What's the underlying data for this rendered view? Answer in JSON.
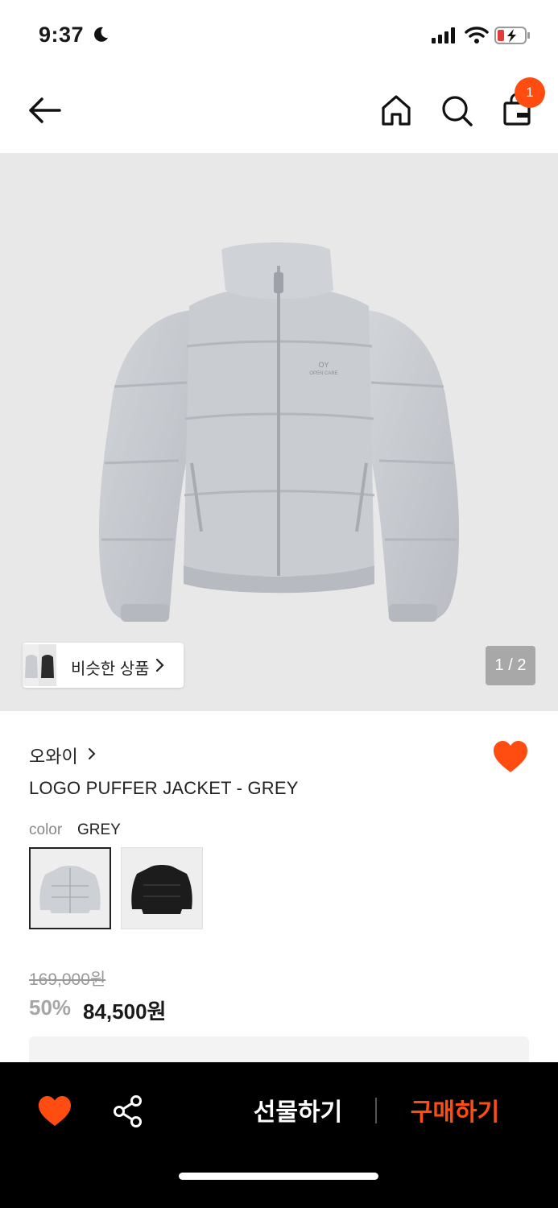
{
  "status_bar": {
    "time": "9:37"
  },
  "header": {
    "cart_count": "1"
  },
  "gallery": {
    "similar_label": "비슷한 상품",
    "page_indicator": "1 / 2"
  },
  "product": {
    "brand": "오와이",
    "name": "LOGO PUFFER JACKET - GREY",
    "color_label": "color",
    "color_value": "GREY",
    "original_price": "169,000원",
    "discount": "50%",
    "sale_price": "84,500원",
    "wishlisted": true
  },
  "colors": {
    "accent": "#ff4d12",
    "bar": "#000000"
  },
  "bottom_bar": {
    "gift_label": "선물하기",
    "buy_label": "구매하기"
  },
  "icons": [
    "moon-icon",
    "signal-icon",
    "wifi-icon",
    "battery-icon",
    "back-arrow-icon",
    "home-icon",
    "search-icon",
    "shopping-bag-icon",
    "heart-icon",
    "share-icon",
    "chevron-right-icon"
  ]
}
